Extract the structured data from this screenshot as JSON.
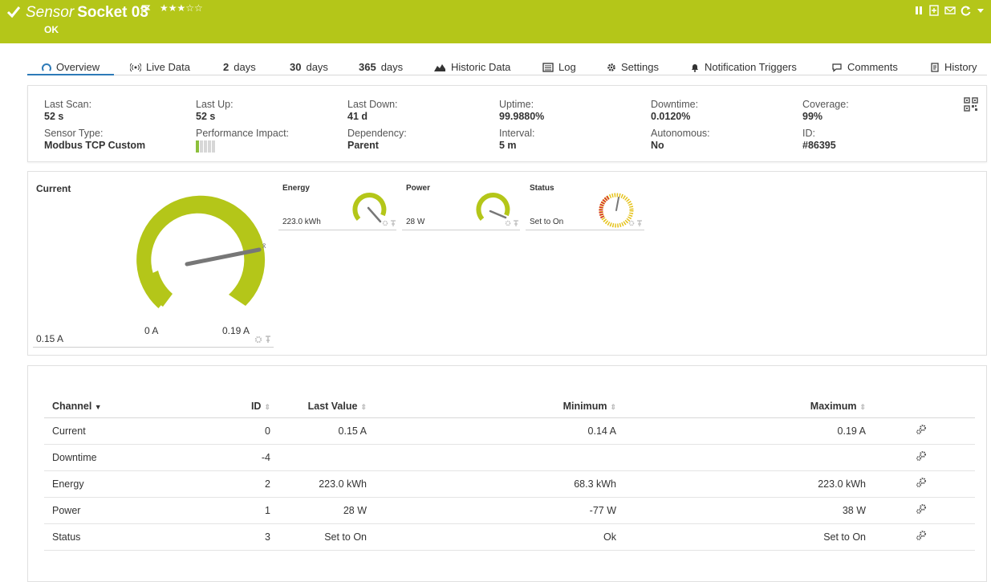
{
  "header": {
    "title_prefix": "Sensor",
    "title_name": "Socket 03",
    "stars": "★★★☆☆",
    "status": "OK",
    "icons": [
      "pause-icon",
      "clone-icon",
      "mail-icon",
      "refresh-icon",
      "caret-down-icon"
    ],
    "colors": {
      "bar": "#b4c619",
      "text": "#ffffff"
    }
  },
  "tabs": [
    {
      "label": "Overview",
      "icon": "overview-icon"
    },
    {
      "label": "Live Data",
      "icon": "live-data-icon"
    },
    {
      "bold": "2",
      "label": "days"
    },
    {
      "bold": "30",
      "label": "days"
    },
    {
      "bold": "365",
      "label": "days"
    },
    {
      "label": "Historic Data",
      "icon": "historic-data-icon"
    },
    {
      "label": "Log",
      "icon": "log-icon"
    },
    {
      "label": "Settings",
      "icon": "settings-icon"
    },
    {
      "label": "Notification Triggers",
      "icon": "bell-icon"
    },
    {
      "label": "Comments",
      "icon": "comment-icon"
    },
    {
      "label": "History",
      "icon": "history-icon"
    }
  ],
  "info": {
    "last_scan": {
      "label": "Last Scan:",
      "value": "52 s"
    },
    "last_up": {
      "label": "Last Up:",
      "value": "52 s"
    },
    "last_down": {
      "label": "Last Down:",
      "value": "41 d"
    },
    "uptime": {
      "label": "Uptime:",
      "value": "99.9880%"
    },
    "downtime": {
      "label": "Downtime:",
      "value": "0.0120%"
    },
    "coverage": {
      "label": "Coverage:",
      "value": "99%"
    },
    "sensor_type": {
      "label": "Sensor Type:",
      "value": "Modbus TCP Custom"
    },
    "performance_impact": {
      "label": "Performance Impact:",
      "level": 1,
      "max": 5
    },
    "dependency": {
      "label": "Dependency:",
      "value": "Parent"
    },
    "interval": {
      "label": "Interval:",
      "value": "5 m"
    },
    "autonomous": {
      "label": "Autonomous:",
      "value": "No"
    },
    "id": {
      "label": "ID:",
      "value": "#86395"
    }
  },
  "gauges": {
    "current": {
      "title": "Current",
      "value": "0.15 A",
      "min_label": "0 A",
      "max_label": "0.19 A",
      "avg_symbol": "x̄",
      "color": "#b4c619"
    },
    "energy": {
      "title": "Energy",
      "value": "223.0 kWh"
    },
    "power": {
      "title": "Power",
      "value": "28 W"
    },
    "status": {
      "title": "Status",
      "value": "Set to On"
    }
  },
  "table": {
    "headers": {
      "channel": "Channel",
      "id": "ID",
      "last_value": "Last Value",
      "minimum": "Minimum",
      "maximum": "Maximum"
    },
    "rows": [
      {
        "channel": "Current",
        "id": "0",
        "last_value": "0.15 A",
        "minimum": "0.14 A",
        "maximum": "0.19 A"
      },
      {
        "channel": "Downtime",
        "id": "-4",
        "last_value": "",
        "minimum": "",
        "maximum": ""
      },
      {
        "channel": "Energy",
        "id": "2",
        "last_value": "223.0 kWh",
        "minimum": "68.3 kWh",
        "maximum": "223.0 kWh"
      },
      {
        "channel": "Power",
        "id": "1",
        "last_value": "28 W",
        "minimum": "-77 W",
        "maximum": "38 W"
      },
      {
        "channel": "Status",
        "id": "3",
        "last_value": "Set to On",
        "minimum": "Ok",
        "maximum": "Set to On"
      }
    ]
  }
}
